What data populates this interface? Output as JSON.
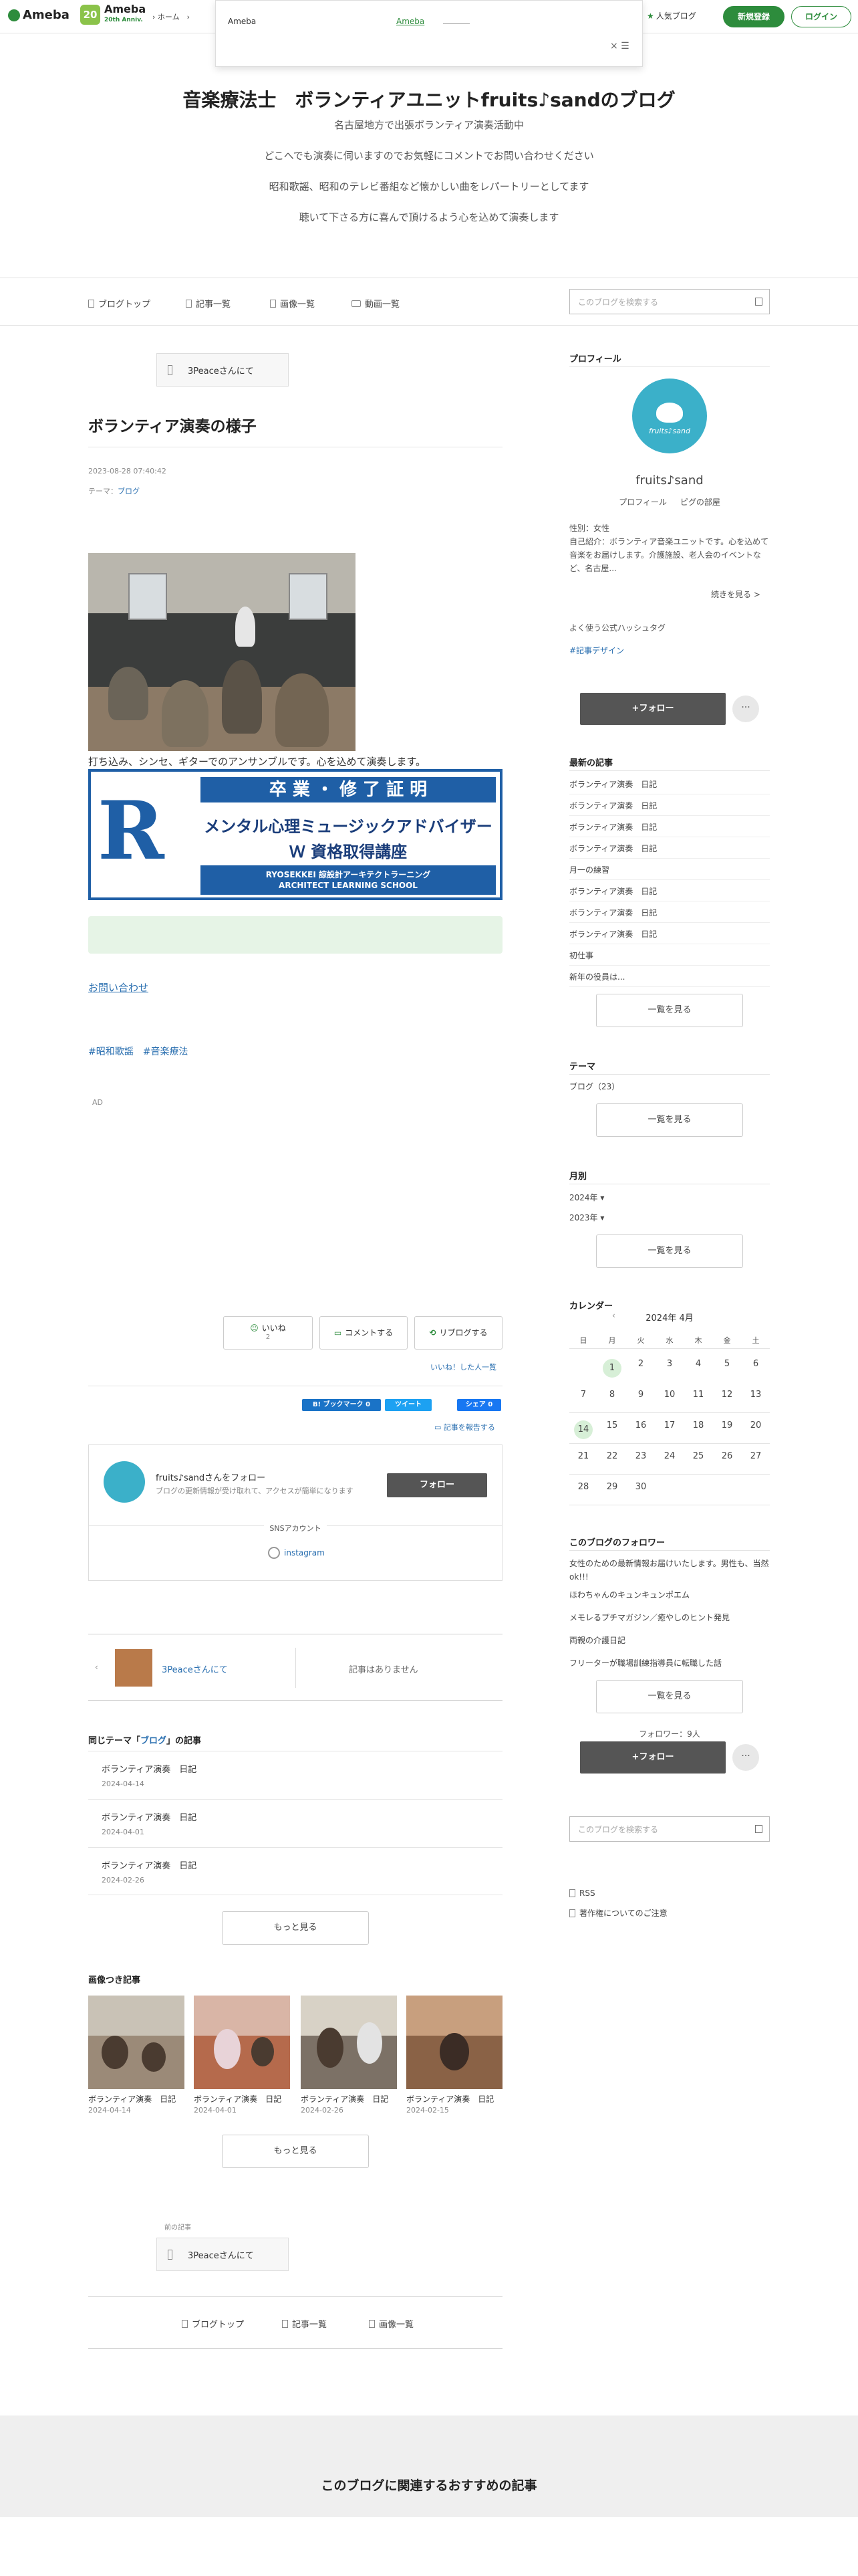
{
  "topbar": {
    "logo": "Ameba",
    "anniv_num": "20",
    "anniv_title": "Ameba",
    "anniv_sub": "20th Anniv.",
    "breadcrumb": "› ホーム　›",
    "popular": "人気ブログ",
    "signup": "新規登録",
    "login": "ログイン"
  },
  "popup": {
    "title": "Ameba",
    "link": "Ameba",
    "close": "× ☰"
  },
  "header": {
    "title": "音楽療法士　ボランティアユニットfruits♪sandのブログ",
    "desc": [
      "名古屋地方で出張ボランティア演奏活動中",
      "どこへでも演奏に伺いますのでお気軽にコメントでお問い合わせください",
      "昭和歌謡、昭和のテレビ番組など懐かしい曲をレパートリーとしてます",
      "聴いて下さる方に喜んで頂けるよう心を込めて演奏します"
    ]
  },
  "nav": {
    "items": [
      "ブログトップ",
      "記事一覧",
      "画像一覧",
      "動画一覧"
    ],
    "search_placeholder": "このブログを検索する"
  },
  "entry": {
    "prev_top": "3Peaceさんにて",
    "title": "ボランティア演奏の様子",
    "date": "2023-08-28 07:40:42",
    "theme_label": "テーマ：",
    "theme": "ブログ",
    "caption": "打ち込み、シンセ、ギターでのアンサンブルです。心を込めて演奏します。",
    "cert": {
      "logo": "R",
      "band": "卒 業 ・ 修 了 証 明",
      "line1": "メンタル心理ミュージックアドバイザー",
      "line2": "Ｗ 資格取得講座",
      "foot1": "RYOSEKKEI 諒設計アーキテクトラーニング",
      "foot2": "ARCHITECT LEARNING SCHOOL"
    },
    "contact": "お問い合わせ",
    "tags": [
      "#昭和歌謡",
      "#音楽療法"
    ],
    "ad": "AD"
  },
  "actions": {
    "like": "いいね",
    "like_count": "2",
    "comment": "コメントする",
    "reblog": "リブログする",
    "liked_list": "いいね！した人一覧",
    "hatena": "B! ブックマーク",
    "hatena_count": "0",
    "tweet": "ツイート",
    "fb": "シェア",
    "fb_count": "0",
    "report": "記事を報告する"
  },
  "follow_box": {
    "title": "fruits♪sandさんをフォロー",
    "sub": "ブログの更新情報が受け取れて、アクセスが簡単になります",
    "button": "フォロー",
    "sns_label": "SNSアカウント",
    "instagram": "instagram"
  },
  "prevnext": {
    "prev": "3Peaceさんにて",
    "next": "記事はありません"
  },
  "related": {
    "title_pre": "同じテーマ「",
    "theme": "ブログ",
    "title_post": "」の記事",
    "items": [
      {
        "title": "ボランティア演奏　日記",
        "date": "2024-04-14"
      },
      {
        "title": "ボランティア演奏　日記",
        "date": "2024-04-01"
      },
      {
        "title": "ボランティア演奏　日記",
        "date": "2024-02-26"
      }
    ],
    "more": "もっと見る"
  },
  "image_articles": {
    "title": "画像つき記事",
    "items": [
      {
        "title": "ボランティア演奏　日記",
        "date": "2024-04-14"
      },
      {
        "title": "ボランティア演奏　日記",
        "date": "2024-04-01"
      },
      {
        "title": "ボランティア演奏　日記",
        "date": "2024-02-26"
      },
      {
        "title": "ボランティア演奏　日記",
        "date": "2024-02-15"
      }
    ],
    "more": "もっと見る"
  },
  "prev_article": {
    "label": "前の記事",
    "title": "3Peaceさんにて"
  },
  "footnav": {
    "items": [
      "ブログトップ",
      "記事一覧",
      "画像一覧"
    ]
  },
  "recommend": {
    "title": "このブログに関連するおすすめの記事"
  },
  "sidebar": {
    "profile_title": "プロフィール",
    "avatar_text": "fruits♪sand",
    "name": "fruits♪sand",
    "links": [
      "プロフィール",
      "ピグの部屋"
    ],
    "text": [
      "性別：女性",
      "自己紹介：ボランティア音楽ユニットです。心を込めて音楽をお届けします。介護施設、老人会のイベントなど、名古屋..."
    ],
    "more": "続きを見る >",
    "hash_label": "よく使う公式ハッシュタグ",
    "hash": "#記事デザイン",
    "follow": "+フォロー",
    "dots": "···",
    "recent_title": "最新の記事",
    "recent": [
      "ボランティア演奏　日記",
      "ボランティア演奏　日記",
      "ボランティア演奏　日記",
      "ボランティア演奏　日記",
      "月一の練習",
      "ボランティア演奏　日記",
      "ボランティア演奏　日記",
      "ボランティア演奏　日記",
      "初仕事",
      "新年の役員は..."
    ],
    "list_all": "一覧を見る",
    "theme_title": "テーマ",
    "theme_item": "ブログ（23）",
    "monthly_title": "月別",
    "months": [
      "2024年",
      "2023年"
    ],
    "calendar_title": "カレンダー",
    "calendar_month": "2024年 4月",
    "calendar_prev": "‹",
    "dow": [
      "日",
      "月",
      "火",
      "水",
      "木",
      "金",
      "土"
    ],
    "weeks": [
      [
        "",
        "1",
        "2",
        "3",
        "4",
        "5",
        "6"
      ],
      [
        "7",
        "8",
        "9",
        "10",
        "11",
        "12",
        "13"
      ],
      [
        "14",
        "15",
        "16",
        "17",
        "18",
        "19",
        "20"
      ],
      [
        "21",
        "22",
        "23",
        "24",
        "25",
        "26",
        "27"
      ],
      [
        "28",
        "29",
        "30",
        "",
        "",
        "",
        ""
      ]
    ],
    "highlighted_days": [
      "1",
      "14"
    ],
    "followers_title": "このブログのフォロワー",
    "followers": [
      "女性のための最新情報お届けいたします。男性も、当然ok!!!",
      "ほわちゃんのキュンキュンポエム",
      "メモレるプチマガジン／癒やしのヒント発見",
      "両親の介護日記",
      "フリーターが職場訓練指導員に転職した話"
    ],
    "followers_count": "フォロワー：9人",
    "search_placeholder": "このブログを検索する",
    "rss": "RSS",
    "copyright": "著作権についてのご注意"
  },
  "colors": {
    "accent_green": "#2d8c3c",
    "link_blue": "#2a6fb0",
    "dark_button": "#555555",
    "cert_blue": "#1f5fa6"
  }
}
